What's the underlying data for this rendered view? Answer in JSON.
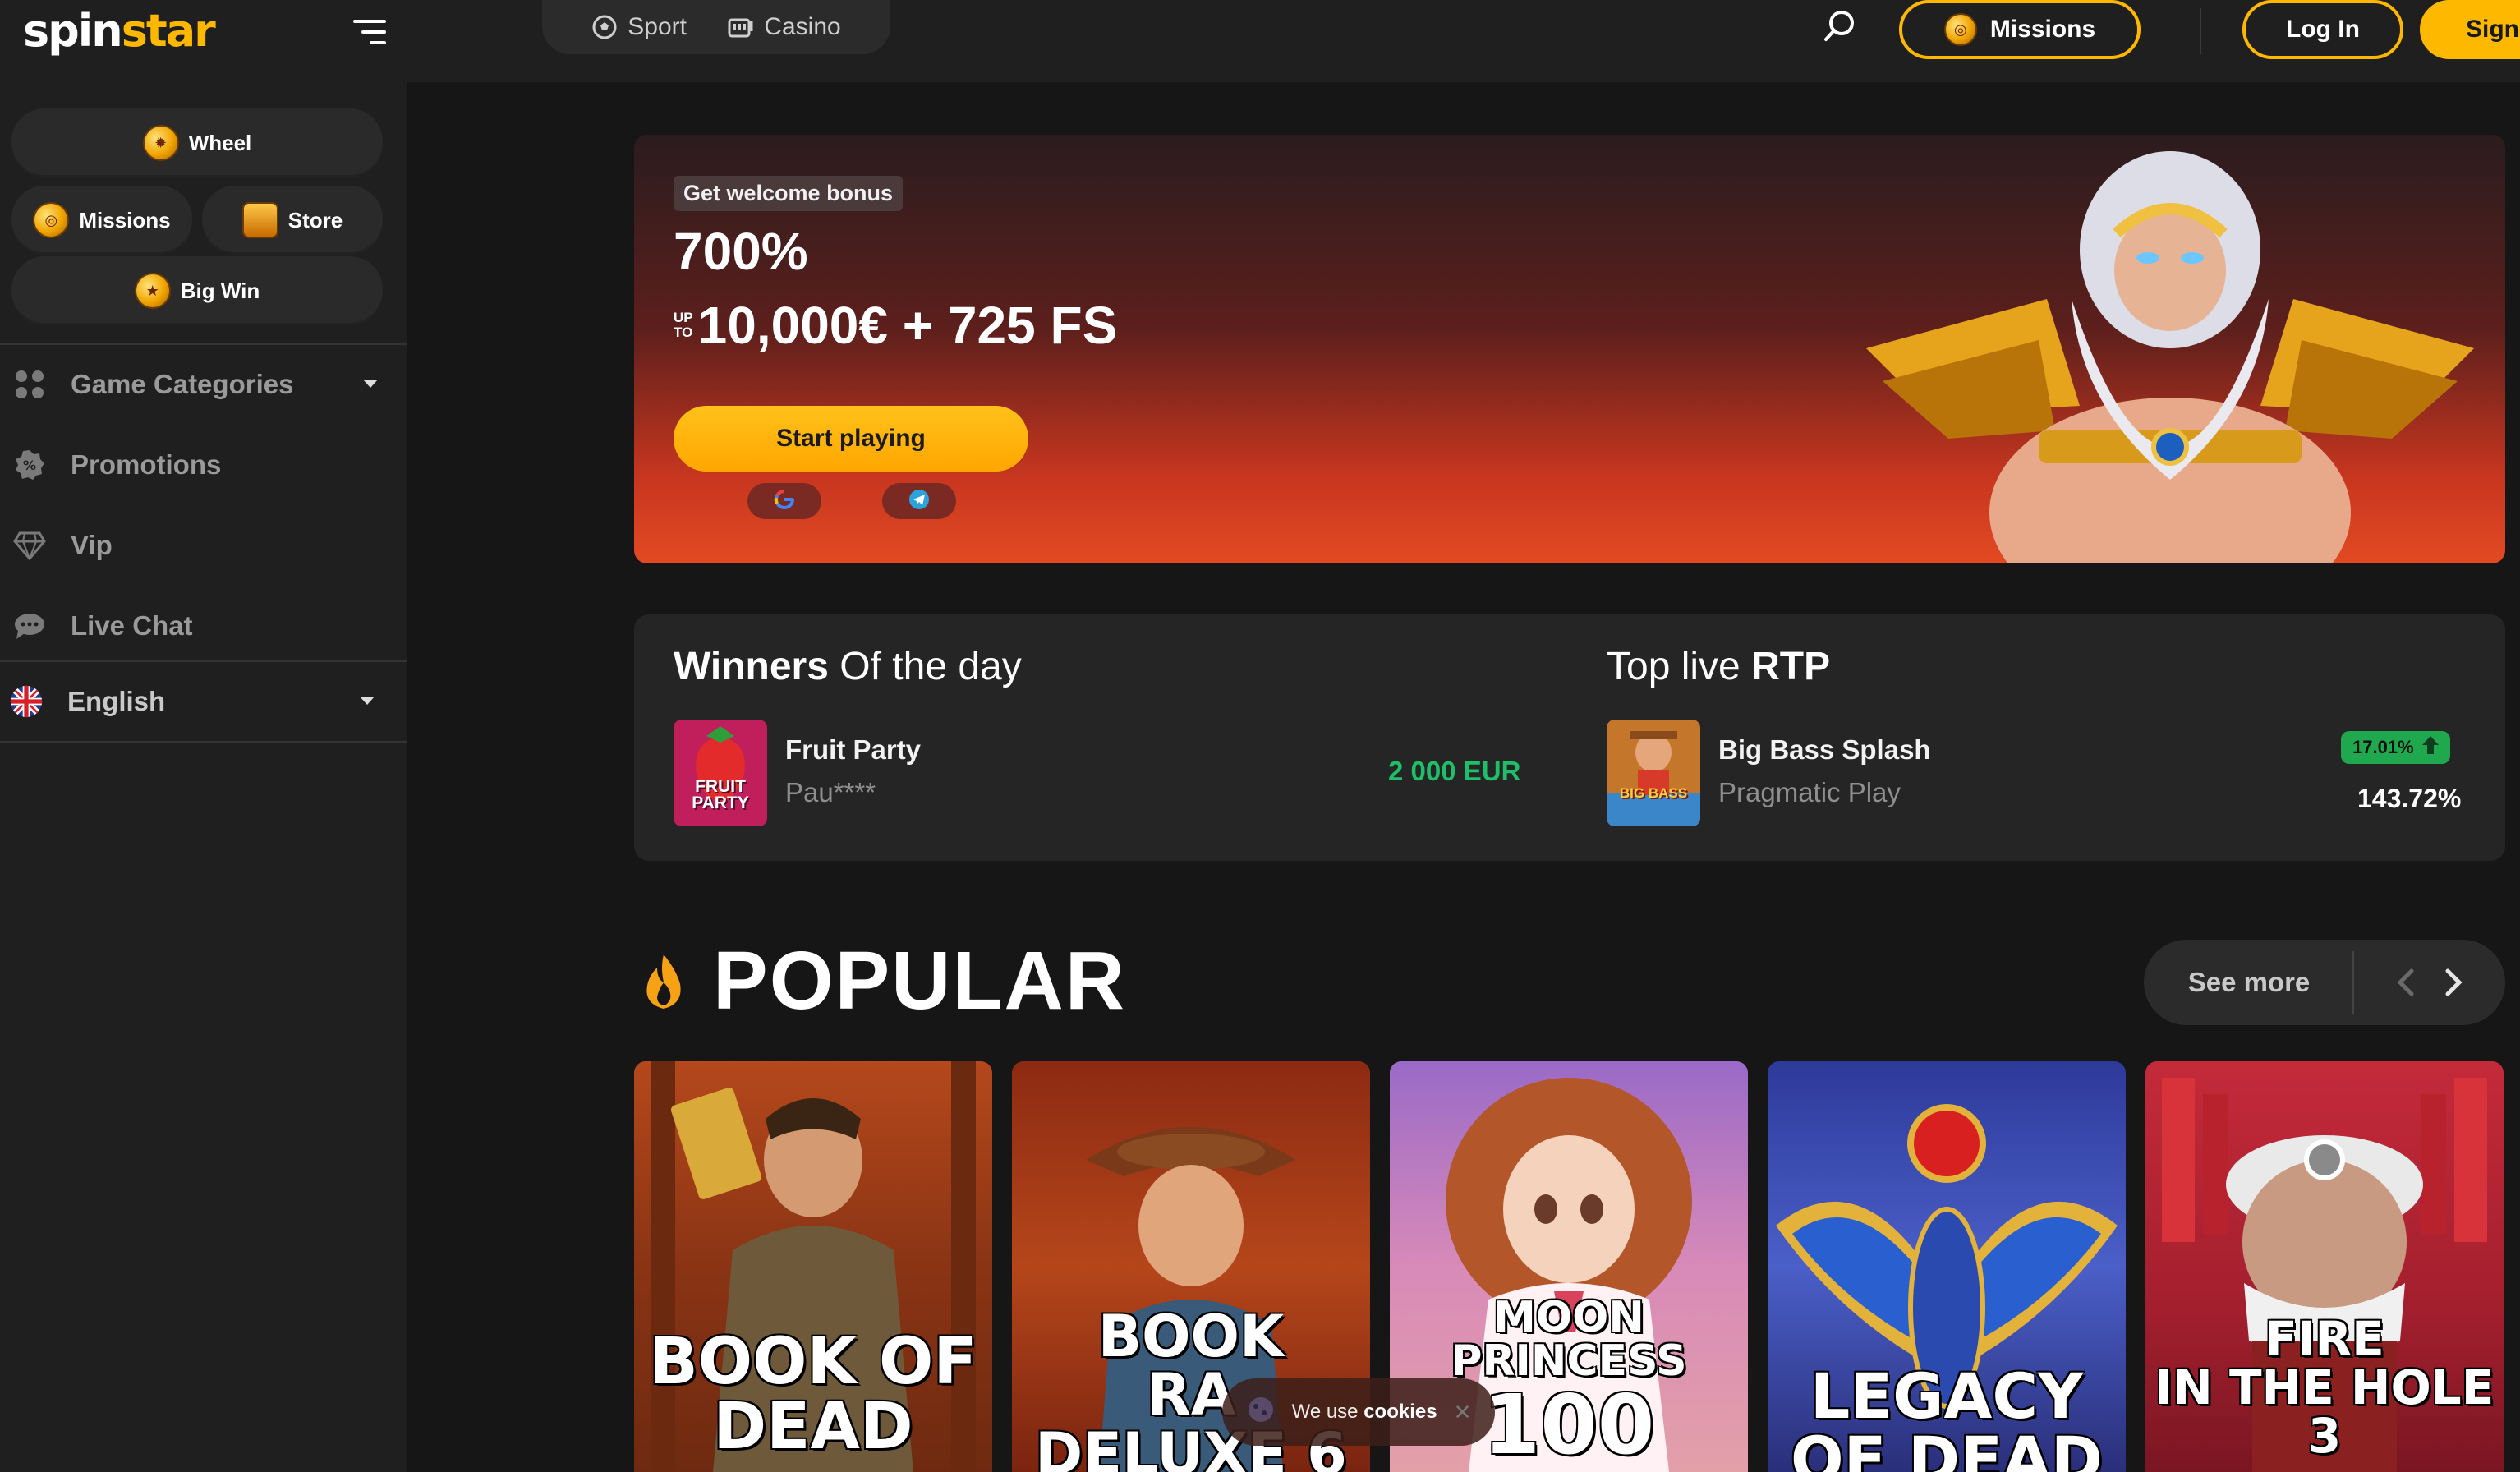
{
  "brand": {
    "logo_part1": "spin",
    "logo_part2": "star"
  },
  "topnav": {
    "tabs": [
      {
        "label": "Sport",
        "icon": "soccer-ball-icon"
      },
      {
        "label": "Casino",
        "icon": "slot-machine-icon"
      }
    ],
    "missions_label": "Missions",
    "login_label": "Log In",
    "signup_label": "Sign"
  },
  "sidebar": {
    "quick": {
      "wheel": "Wheel",
      "missions": "Missions",
      "store": "Store",
      "big_win": "Big Win"
    },
    "links": [
      {
        "label": "Game Categories",
        "icon": "categories-icon"
      },
      {
        "label": "Promotions",
        "icon": "badge-percent-icon"
      },
      {
        "label": "Vip",
        "icon": "diamond-icon"
      },
      {
        "label": "Live Chat",
        "icon": "chat-bubble-icon"
      }
    ],
    "language": "English"
  },
  "hero": {
    "badge": "Get welcome bonus",
    "percent": "700%",
    "up": "UP",
    "to": "TO",
    "amount": "10,000€ + 725 FS",
    "cta": "Start playing"
  },
  "winners": {
    "title_bold": "Winners",
    "title_rest": " Of the day",
    "game": "Fruit Party",
    "thumb_top": "FRUIT",
    "thumb_bottom": "PARTY",
    "user": "Pau****",
    "amount": "2 000 EUR"
  },
  "rtp": {
    "title_rest": "Top live ",
    "title_bold": "RTP",
    "game": "Big Bass Splash",
    "thumb_label": "BIG BASS",
    "provider": "Pragmatic Play",
    "badge": "17.01%",
    "value": "143.72%"
  },
  "popular": {
    "title": "POPULAR",
    "see_more": "See more",
    "cards": [
      {
        "title_line1": "BOOK OF",
        "title_line2": "DEAD"
      },
      {
        "title_line1": "BOOK",
        "title_line2": "RA DELUXE 6"
      },
      {
        "title_line1": "MOON PRINCESS",
        "title_line2": "100"
      },
      {
        "title_line1": "LEGACY",
        "title_line2": "OF DEAD"
      },
      {
        "title_line1": "FIRE",
        "title_line2": "IN THE HOLE 3"
      }
    ]
  },
  "cookie": {
    "text": "We use",
    "bold": "cookies"
  },
  "colors": {
    "accent": "#ffb800",
    "win_green": "#1fbf6a",
    "bg": "#161616",
    "panel": "#1f1f1f"
  }
}
